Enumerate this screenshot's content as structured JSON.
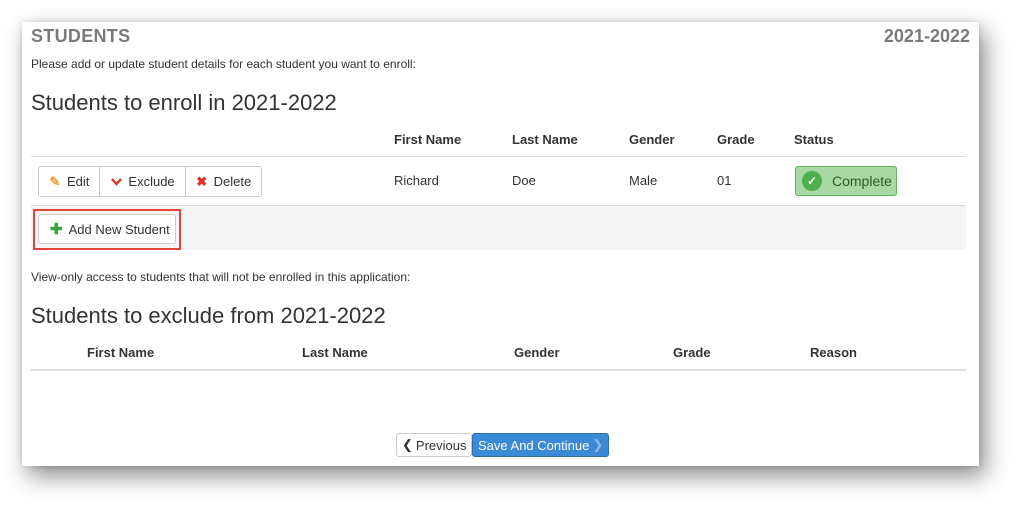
{
  "header": {
    "title": "STUDENTS",
    "year": "2021-2022"
  },
  "intro": "Please add or update student details for each student you want to enroll:",
  "enroll": {
    "title": "Students to enroll in 2021-2022",
    "columns": [
      "First Name",
      "Last Name",
      "Gender",
      "Grade",
      "Status"
    ],
    "row": {
      "actions": {
        "edit": "Edit",
        "exclude": "Exclude",
        "delete": "Delete"
      },
      "first_name": "Richard",
      "last_name": "Doe",
      "gender": "Male",
      "grade": "01",
      "status": "Complete"
    },
    "add_button": "Add New Student"
  },
  "viewonly_note": "View-only access to students that will not be enrolled in this application:",
  "exclude": {
    "title": "Students to exclude from 2021-2022",
    "columns": [
      "First Name",
      "Last Name",
      "Gender",
      "Grade",
      "Reason"
    ]
  },
  "nav": {
    "previous": "Previous",
    "save_continue": "Save And Continue"
  },
  "colors": {
    "accent": "#3a8ad6",
    "success": "#4caf50",
    "highlight": "#e0453c"
  },
  "icons": {
    "edit": "pencil-icon",
    "exclude": "chevron-down-icon",
    "delete": "x-icon",
    "add": "plus-icon",
    "status": "check-circle-icon"
  }
}
